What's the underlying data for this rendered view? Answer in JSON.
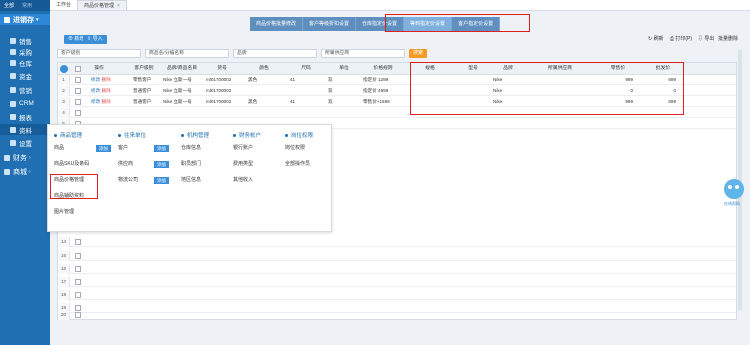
{
  "sidebar": {
    "top_tabs": [
      "全部",
      "常用"
    ],
    "main": "进销存",
    "items": [
      {
        "label": "销售",
        "icon": "cart-icon"
      },
      {
        "label": "采购",
        "icon": "bag-icon"
      },
      {
        "label": "仓库",
        "icon": "warehouse-icon"
      },
      {
        "label": "资金",
        "icon": "money-icon"
      },
      {
        "label": "营销",
        "icon": "megaphone-icon"
      },
      {
        "label": "CRM",
        "icon": "people-icon"
      },
      {
        "label": "报表",
        "icon": "chart-icon"
      },
      {
        "label": "资料",
        "icon": "folder-icon"
      },
      {
        "label": "设置",
        "icon": "gear-icon"
      }
    ],
    "bottom": [
      {
        "label": "财务",
        "icon": "finance-icon"
      },
      {
        "label": "商城",
        "icon": "shop-icon"
      }
    ]
  },
  "tabs": [
    {
      "label": "工作台"
    },
    {
      "label": "商品价格管理"
    }
  ],
  "settings_tabs": [
    "商品价格批量修改",
    "客户等级折扣设置",
    "仓库指定价设置",
    "等到指定价设置",
    "客户指定价设置"
  ],
  "toolbar": {
    "add": "新增",
    "import": "导入",
    "refresh": "刷新",
    "print": "打印(P)",
    "export": "导出",
    "batch_delete": "批量删除"
  },
  "filters": {
    "customer": "客户级别",
    "product": "商品名/分编名称",
    "brand": "品牌",
    "warehouse": "所属供应商",
    "search": "搜索"
  },
  "columns": [
    "操作",
    "客户级别",
    "品牌/商品名目",
    "货号",
    "颜色",
    "尺码",
    "单位",
    "价格规则",
    "规格",
    "型号",
    "品牌",
    "所属供应商",
    "零售价",
    "批发价"
  ],
  "rows": [
    {
      "n": "1",
      "op_edit": "修改",
      "op_del": "删除",
      "level": "零售客户",
      "name": "Nike 立斯一号",
      "code": "ml01700002",
      "color": "黑色",
      "size": "41",
      "unit": "双",
      "rule": "指定价 1299",
      "brand": "Nike",
      "retail": "999",
      "wholesale": "699"
    },
    {
      "n": "2",
      "op_edit": "修改",
      "op_del": "删除",
      "level": "普通客户",
      "name": "Nike 立斯一号",
      "code": "ml01700002",
      "color": "",
      "size": "",
      "unit": "双",
      "rule": "指定价 4999",
      "brand": "Nike",
      "retail": "0",
      "wholesale": "0"
    },
    {
      "n": "3",
      "op_edit": "修改",
      "op_del": "删除",
      "level": "普通客户",
      "name": "Nike 立斯一号",
      "code": "ml01700002",
      "color": "黑色",
      "size": "41",
      "unit": "双",
      "rule": "零售价+1599",
      "brand": "Nike",
      "retail": "999",
      "wholesale": "699"
    }
  ],
  "empty_rows": [
    "4",
    "5",
    "6",
    "7",
    "8",
    "9",
    "10",
    "11",
    "12",
    "13",
    "14",
    "15",
    "16",
    "17",
    "18",
    "19",
    "20"
  ],
  "mega": {
    "cols": [
      {
        "title": "商品管理",
        "items": [
          {
            "label": "商品",
            "add": "添加"
          },
          {
            "label": "商品SKU及条码"
          },
          {
            "label": "商品价格管理"
          },
          {
            "label": "商品辅助资料"
          },
          {
            "label": "图片管理"
          }
        ]
      },
      {
        "title": "往来单位",
        "items": [
          {
            "label": "客户",
            "add": "添加"
          },
          {
            "label": "供应商",
            "add": "添加"
          },
          {
            "label": "物流公司",
            "add": "添加"
          }
        ]
      },
      {
        "title": "机构管理",
        "items": [
          {
            "label": "仓库信息"
          },
          {
            "label": "职员部门"
          },
          {
            "label": "地区信息"
          }
        ]
      },
      {
        "title": "财务帐户",
        "items": [
          {
            "label": "银行账户"
          },
          {
            "label": "费用类型"
          },
          {
            "label": "其他收入"
          }
        ]
      },
      {
        "title": "岗位权限",
        "items": [
          {
            "label": "岗位权限"
          },
          {
            "label": "全部操作员"
          }
        ]
      }
    ]
  },
  "assistant": "在线帮助"
}
